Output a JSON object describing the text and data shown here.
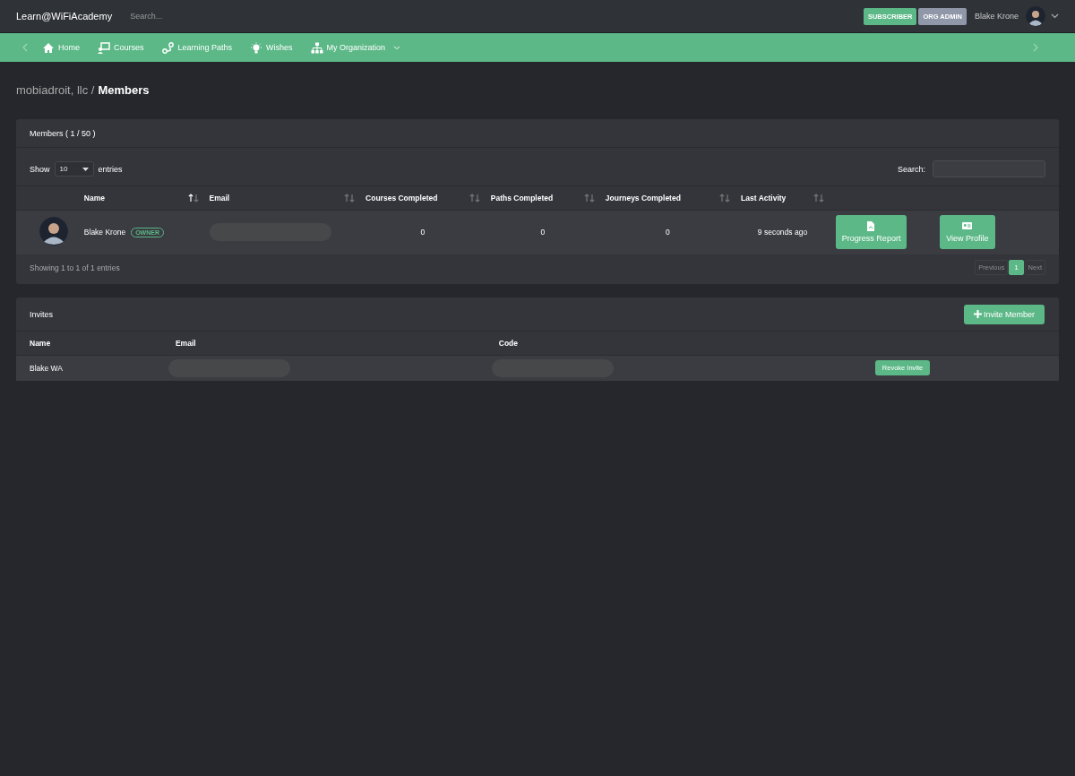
{
  "header": {
    "brand": "Learn@WiFiAcademy",
    "search": {
      "placeholder": "Search..."
    },
    "badges": [
      {
        "label": "SUBSCRIBER",
        "color": "#5cb887"
      },
      {
        "label": "ORG ADMIN",
        "color": "#8f97a8"
      }
    ],
    "user": {
      "name": "Blake Krone"
    }
  },
  "nav": {
    "items": [
      {
        "label": "Home",
        "dropdown": false
      },
      {
        "label": "Courses",
        "dropdown": false
      },
      {
        "label": "Learning Paths",
        "dropdown": false
      },
      {
        "label": "Wishes",
        "dropdown": false
      },
      {
        "label": "My Organization",
        "dropdown": true
      }
    ]
  },
  "breadcrumb": {
    "parent": "mobiadroit, llc /",
    "current": "Members"
  },
  "members": {
    "title": "Members ( 1 / 50 )",
    "show_label": "Show",
    "page_size": "10",
    "entries_label": "entries",
    "search_label": "Search:",
    "columns": [
      {
        "label": "Name",
        "sorted": true
      },
      {
        "label": "Email",
        "sorted": false
      },
      {
        "label": "Courses Completed",
        "sorted": false
      },
      {
        "label": "Paths Completed",
        "sorted": false
      },
      {
        "label": "Journeys Completed",
        "sorted": false
      },
      {
        "label": "Last Activity",
        "sorted": false
      }
    ],
    "rows": [
      {
        "name": "Blake Krone",
        "role": "OWNER",
        "email_redacted": true,
        "courses": "0",
        "paths": "0",
        "journeys": "0",
        "last_activity": "9 seconds ago",
        "actions": [
          "Progress Report",
          "View Profile"
        ]
      }
    ],
    "info": "Showing 1 to 1 of 1 entries",
    "pagination": [
      {
        "label": "Previous",
        "disabled": true,
        "selected": false
      },
      {
        "label": "1",
        "disabled": false,
        "selected": true
      },
      {
        "label": "Next",
        "disabled": true,
        "selected": false
      }
    ]
  },
  "invites": {
    "title": "Invites",
    "invite_button": "Invite Member",
    "columns": [
      "Name",
      "Email",
      "Code"
    ],
    "rows": [
      {
        "name": "Blake WA",
        "email_redacted": true,
        "code_redacted": true,
        "action": "Revoke Invite"
      }
    ]
  }
}
